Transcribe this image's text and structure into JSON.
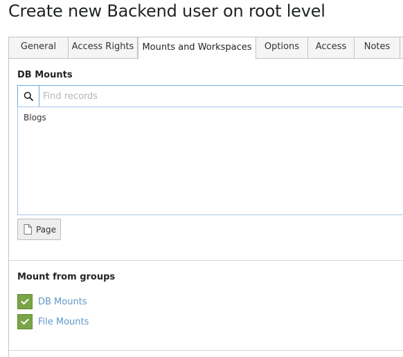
{
  "page": {
    "title": "Create new Backend user on root level"
  },
  "tabs": [
    {
      "label": "General",
      "active": false
    },
    {
      "label": "Access Rights",
      "active": false
    },
    {
      "label": "Mounts and Workspaces",
      "active": true
    },
    {
      "label": "Options",
      "active": false
    },
    {
      "label": "Access",
      "active": false
    },
    {
      "label": "Notes",
      "active": false
    }
  ],
  "db_mounts": {
    "label": "DB Mounts",
    "search_placeholder": "Find records",
    "items": [
      "Blogs"
    ],
    "add_button_label": "Page"
  },
  "mount_from_groups": {
    "label": "Mount from groups",
    "options": [
      {
        "label": "DB Mounts",
        "checked": true
      },
      {
        "label": "File Mounts",
        "checked": true
      }
    ]
  },
  "colors": {
    "checkbox_green": "#79a548",
    "link_blue": "#5f97c9",
    "focus_blue": "#6daae0"
  }
}
